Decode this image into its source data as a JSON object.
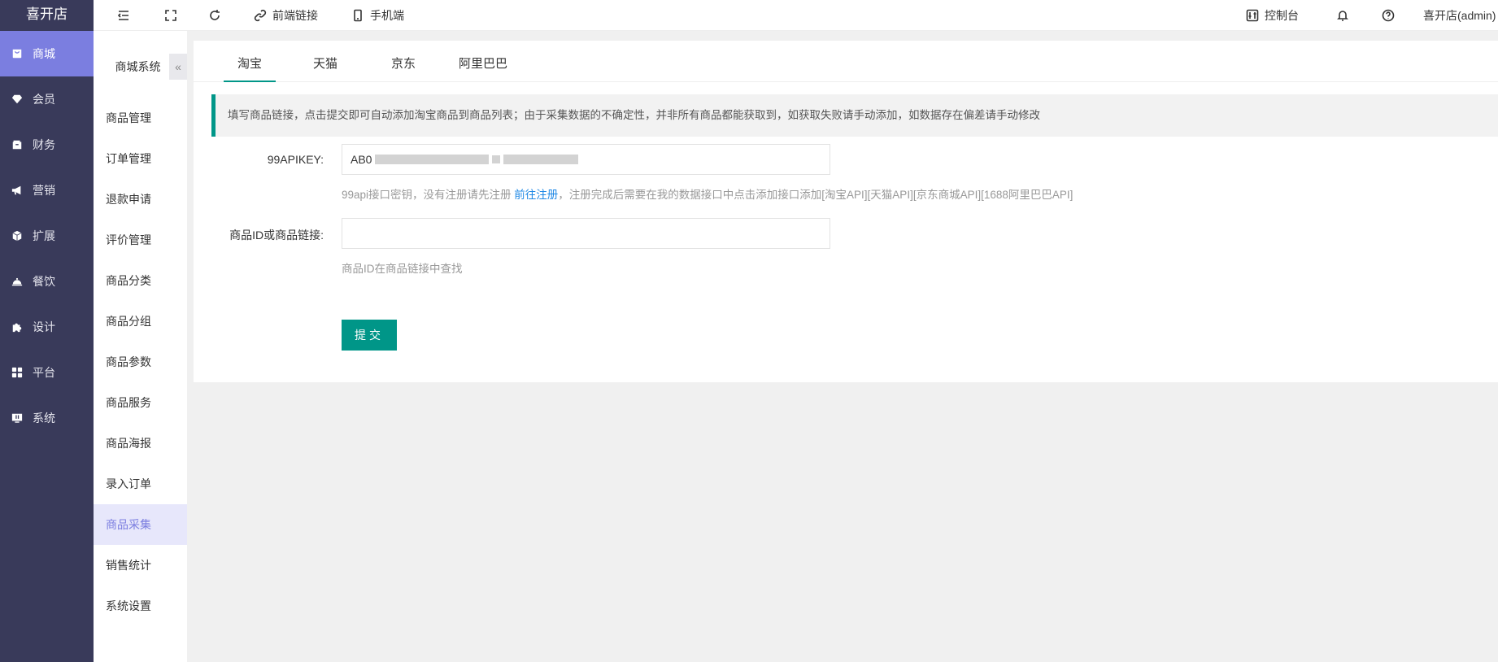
{
  "app": {
    "brand": "喜开店"
  },
  "sidebar": {
    "items": [
      {
        "label": "商城",
        "icon": "store-icon"
      },
      {
        "label": "会员",
        "icon": "diamond-icon"
      },
      {
        "label": "财务",
        "icon": "wallet-icon"
      },
      {
        "label": "营销",
        "icon": "megaphone-icon"
      },
      {
        "label": "扩展",
        "icon": "cube-icon"
      },
      {
        "label": "餐饮",
        "icon": "cloche-icon"
      },
      {
        "label": "设计",
        "icon": "puzzle-icon"
      },
      {
        "label": "平台",
        "icon": "grid-icon"
      },
      {
        "label": "系统",
        "icon": "monitor-icon"
      }
    ],
    "active_index": 0
  },
  "header": {
    "front_link_label": "前端链接",
    "mobile_label": "手机端",
    "console_label": "控制台",
    "user_label": "喜开店(admin)"
  },
  "submenu": {
    "title": "商城系统",
    "collapse_glyph": "«",
    "items": [
      "商品管理",
      "订单管理",
      "退款申请",
      "评价管理",
      "商品分类",
      "商品分组",
      "商品参数",
      "商品服务",
      "商品海报",
      "录入订单",
      "商品采集",
      "销售统计",
      "系统设置"
    ],
    "active_index": 10
  },
  "main": {
    "tabs": [
      "淘宝",
      "天猫",
      "京东",
      "阿里巴巴"
    ],
    "active_tab": 0,
    "notice": "填写商品链接，点击提交即可自动添加淘宝商品到商品列表；由于采集数据的不确定性，并非所有商品都能获取到，如获取失败请手动添加，如数据存在偏差请手动修改",
    "apikey": {
      "label": "99APIKEY:",
      "value": "AB0",
      "tip_before": "99api接口密钥，没有注册请先注册 ",
      "tip_link": "前往注册",
      "tip_after": "，注册完成后需要在我的数据接口中点击添加接口添加[淘宝API][天猫API][京东商城API][1688阿里巴巴API]"
    },
    "goods": {
      "label": "商品ID或商品链接:",
      "value": "",
      "placeholder": "",
      "tip": "商品ID在商品链接中查找"
    },
    "submit_label": "提交"
  },
  "colors": {
    "sidebar_bg": "#393a5a",
    "accent": "#7b7ee0",
    "primary": "#009688",
    "link": "#1e88e5"
  }
}
